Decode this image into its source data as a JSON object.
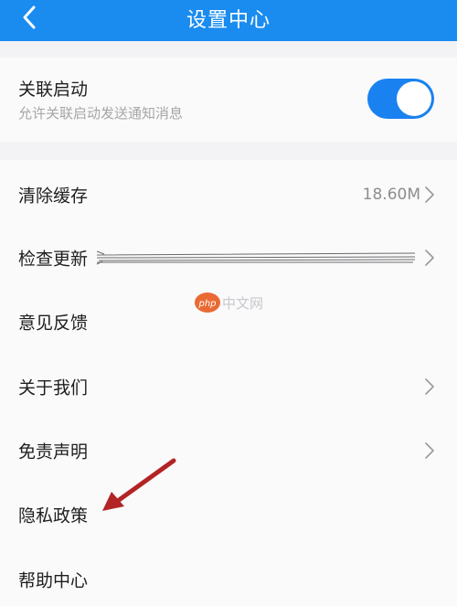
{
  "header": {
    "title": "设置中心"
  },
  "association_start": {
    "title": "关联启动",
    "subtitle": "允许关联启动发送通知消息",
    "enabled": true
  },
  "menu": [
    {
      "label": "清除缓存",
      "value": "18.60M",
      "chevron": true
    },
    {
      "label": "检查更新",
      "value": "",
      "chevron": true,
      "value_obscured": true
    },
    {
      "label": "意见反馈",
      "value": "",
      "chevron": false
    },
    {
      "label": "关于我们",
      "value": "",
      "chevron": true
    },
    {
      "label": "免责声明",
      "value": "",
      "chevron": true
    },
    {
      "label": "隐私政策",
      "value": "",
      "chevron": false
    },
    {
      "label": "帮助中心",
      "value": "",
      "chevron": false
    }
  ],
  "watermark": "php中文网",
  "colors": {
    "header_bg": "#1a8cf0",
    "toggle_on": "#1a82f0",
    "annotation_arrow": "#b32424"
  }
}
